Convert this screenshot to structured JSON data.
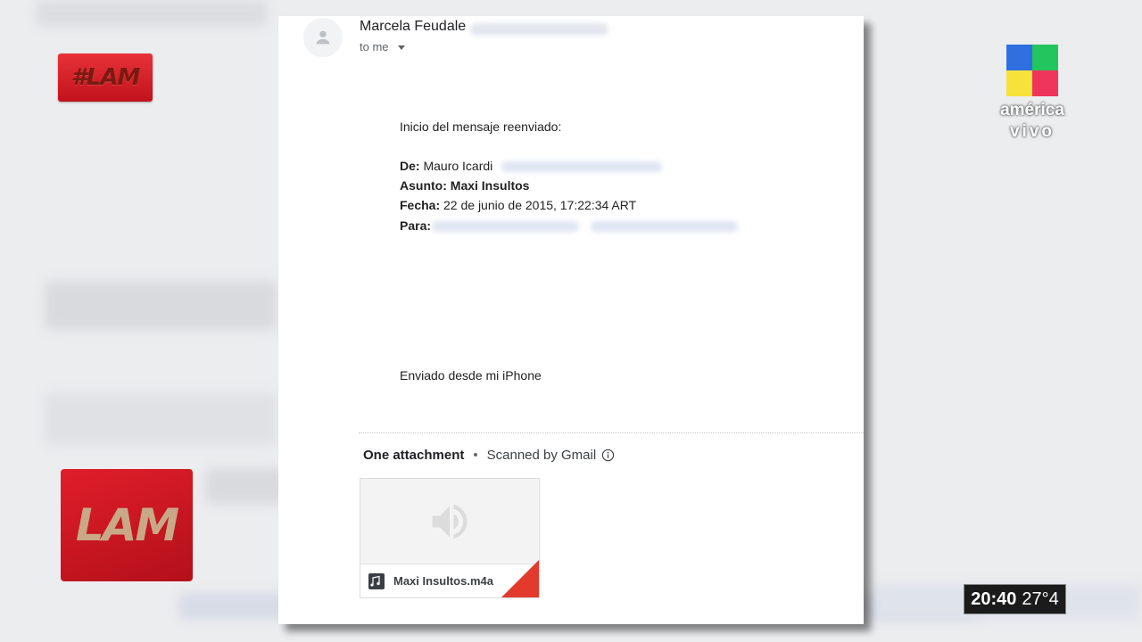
{
  "overlay": {
    "hashtag": "#LAM",
    "show_logo": "LAM",
    "network": {
      "line1": "américa",
      "line2": "vivo"
    },
    "clock": {
      "time": "20:40",
      "temp": "27°4"
    }
  },
  "email": {
    "sender_name": "Marcela Feudale",
    "to_label": "to me",
    "forward_intro": "Inicio del mensaje reenviado:",
    "from_label": "De:",
    "from_value": "Mauro Icardi",
    "subject_label": "Asunto:",
    "subject_value": "Maxi Insultos",
    "date_label": "Fecha:",
    "date_value": "22 de junio de 2015, 17:22:34 ART",
    "to_field_label": "Para:",
    "signature": "Enviado desde mi iPhone",
    "attachment_header": "One attachment",
    "separator": "•",
    "scanned_label": "Scanned by Gmail",
    "attachment_name": "Maxi Insultos.m4a"
  }
}
